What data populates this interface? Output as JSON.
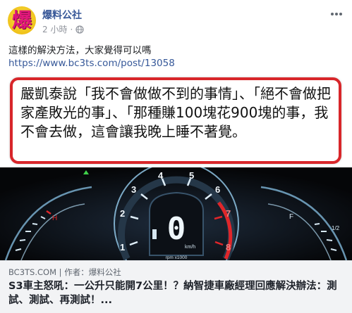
{
  "post": {
    "page_name": "爆料公社",
    "avatar_glyph": "爆",
    "time": "2 小時",
    "separator": "·",
    "privacy_icon": "globe-icon",
    "more_icon": "more-options-icon",
    "text": "這樣的解決方法，大家覺得可以嗎",
    "link": "https://www.bc3ts.com/post/13058"
  },
  "media": {
    "quote": "嚴凱泰說「我不會做做不到的事情」、「絕不會做把家產敗光的事」、「那種賺100塊花900塊的事，我不會去做，這會讓我晚上睡不著覺。",
    "gauge": {
      "ticks": [
        "1",
        "2",
        "3",
        "4",
        "5",
        "6",
        "7",
        "8"
      ],
      "speed": "0",
      "speed_unit": "km/h",
      "rpm_label": "rpm x1000",
      "temp_high": "H",
      "fuel_full": "F",
      "fuel_half": "1/2"
    },
    "colors": {
      "quote_border": "#d8262a",
      "redline": "#e0262a",
      "accent_green": "#3fd14a"
    }
  },
  "link_card": {
    "source": "BC3TS.COM | 作者：爆料公社",
    "headline": "S3車主怒吼：一公升只能開7公里！？納智捷車廠經理回應解決辦法：測試、測試、再測試！..."
  }
}
